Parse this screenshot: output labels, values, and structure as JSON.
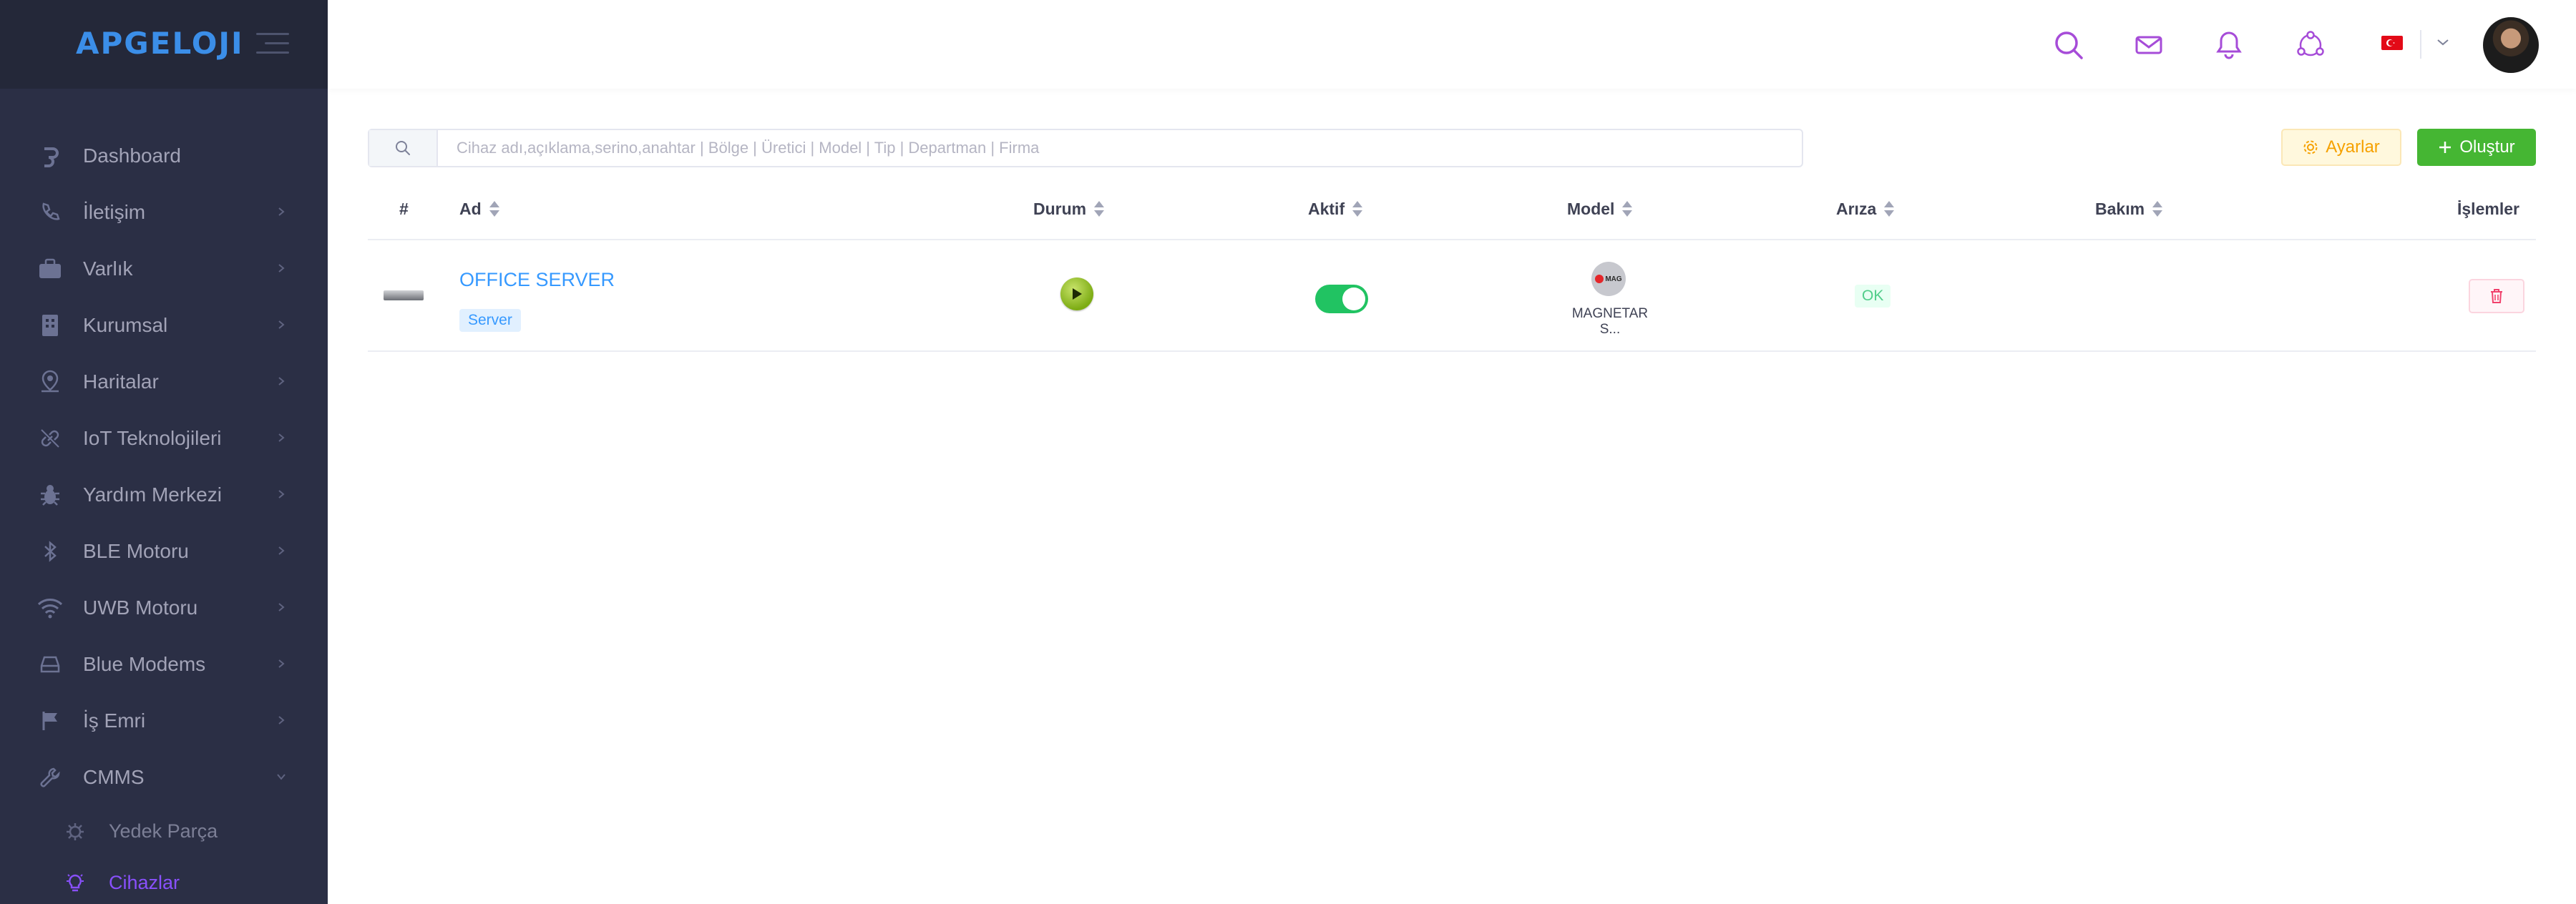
{
  "app": {
    "logo_text": "APGELOJI"
  },
  "sidebar": {
    "items": [
      {
        "label": "Dashboard",
        "icon": "dashboard-icon"
      },
      {
        "label": "İletişim",
        "icon": "phone-icon"
      },
      {
        "label": "Varlık",
        "icon": "assets-icon"
      },
      {
        "label": "Kurumsal",
        "icon": "building-icon"
      },
      {
        "label": "Haritalar",
        "icon": "map-pin-icon"
      },
      {
        "label": "IoT Teknolojileri",
        "icon": "link-icon"
      },
      {
        "label": "Yardım Merkezi",
        "icon": "bug-icon"
      },
      {
        "label": "BLE Motoru",
        "icon": "bluetooth-icon"
      },
      {
        "label": "UWB Motoru",
        "icon": "wifi-icon"
      },
      {
        "label": "Blue Modems",
        "icon": "modem-icon"
      },
      {
        "label": "İş Emri",
        "icon": "flag-icon"
      },
      {
        "label": "CMMS",
        "icon": "wrench-icon"
      }
    ],
    "submenu": [
      {
        "label": "Yedek Parça",
        "icon": "gear-icon"
      },
      {
        "label": "Cihazlar",
        "icon": "lightbulb-icon"
      }
    ]
  },
  "topbar": {
    "icons": [
      "search-icon",
      "mail-icon",
      "bell-icon",
      "users-icon"
    ],
    "language_flag": "turkey-flag-icon"
  },
  "search": {
    "placeholder": "Cihaz adı,açıklama,serino,anahtar | Bölge | Üretici | Model | Tip | Departman | Firma"
  },
  "toolbar": {
    "settings_label": "Ayarlar",
    "create_label": "Oluştur"
  },
  "table": {
    "columns": [
      "#",
      "Ad",
      "Durum",
      "Aktif",
      "Model",
      "Arıza",
      "Bakım",
      "İşlemler"
    ],
    "rows": [
      {
        "name": "OFFICE SERVER",
        "type": "Server",
        "status": "playing",
        "active": true,
        "model_logo_text": "MAG",
        "model": "MAGNETAR S...",
        "fault": "OK",
        "maintenance": ""
      }
    ]
  },
  "colors": {
    "sidebar_bg": "#2b2f45",
    "accent_purple": "#8950fc",
    "primary_blue": "#3699ff",
    "success_green": "#45b633"
  }
}
